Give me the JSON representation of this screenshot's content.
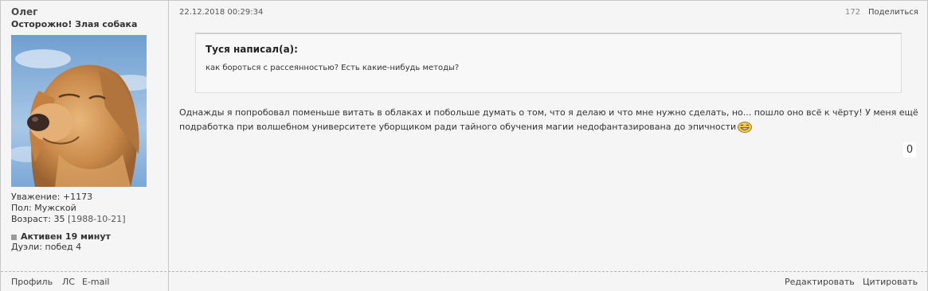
{
  "user": {
    "name": "Олег",
    "title": "Осторожно! Злая собака",
    "respect": "Уважение: +1173",
    "gender": "Пол: Мужской",
    "age_label": "Возраст: 35",
    "birthdate": "[1988-10-21]",
    "active": "Активен 19 минут",
    "duels": "Дуэли: побед 4"
  },
  "post": {
    "date": "22.12.2018 00:29:34",
    "views": "172",
    "share_label": "Поделиться",
    "quote": {
      "author": "Туся написал(а):",
      "text": "как бороться с рассеянностью?  Есть какие-нибудь методы?"
    },
    "text": "Однажды я попробовал поменьше витать в облаках и побольше думать о том, что я делаю и что мне нужно сделать, но... пошло оно всё к чёрту! У меня ещё подработка при волшебном университете уборщиком ради тайного обучения магии недофантазирована до эпичности",
    "rating": "0"
  },
  "footer": {
    "profile": "Профиль",
    "pm": "ЛС",
    "email": "E-mail",
    "edit": "Редактировать",
    "quote": "Цитировать"
  },
  "icons": {
    "avatar": "golden-retriever-dog-photo",
    "smiley": "laughing-smiley-icon",
    "active_marker": "status-square-icon"
  }
}
